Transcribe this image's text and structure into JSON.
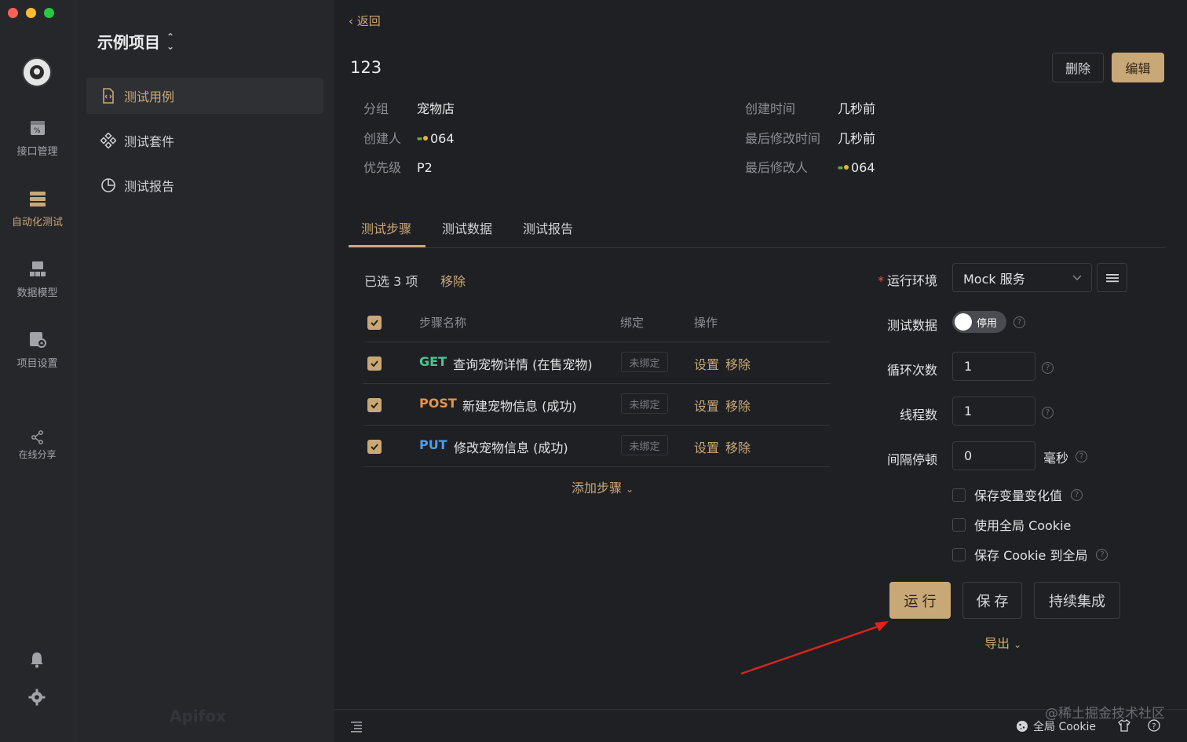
{
  "rail": {
    "items": [
      {
        "label": "接口管理",
        "icon": "api-management-icon"
      },
      {
        "label": "自动化测试",
        "icon": "automation-test-icon",
        "active": true
      },
      {
        "label": "数据模型",
        "icon": "data-model-icon"
      },
      {
        "label": "项目设置",
        "icon": "project-settings-icon"
      },
      {
        "label": "在线分享",
        "icon": "share-icon"
      }
    ]
  },
  "sidebar": {
    "project_title": "示例项目",
    "items": [
      {
        "label": "测试用例",
        "icon": "test-case-icon",
        "active": true
      },
      {
        "label": "测试套件",
        "icon": "test-suite-icon"
      },
      {
        "label": "测试报告",
        "icon": "test-report-icon"
      }
    ],
    "brand": "Apifox"
  },
  "header": {
    "back_label": "返回",
    "title": "123",
    "delete_label": "删除",
    "edit_label": "编辑"
  },
  "meta": {
    "group_key": "分组",
    "group_value": "宠物店",
    "creator_key": "创建人",
    "creator_value": "064",
    "priority_key": "优先级",
    "priority_value": "P2",
    "created_key": "创建时间",
    "created_value": "几秒前",
    "modified_key": "最后修改时间",
    "modified_value": "几秒前",
    "modifier_key": "最后修改人",
    "modifier_value": "064"
  },
  "tabs": [
    {
      "label": "测试步骤",
      "active": true
    },
    {
      "label": "测试数据"
    },
    {
      "label": "测试报告"
    }
  ],
  "steps": {
    "selected_text": "已选 3 项",
    "remove_label": "移除",
    "columns": {
      "name": "步骤名称",
      "bind": "绑定",
      "ops": "操作"
    },
    "rows": [
      {
        "method": "GET",
        "name": "查询宠物详情 (在售宠物)",
        "bind": "未绑定",
        "set": "设置",
        "remove": "移除",
        "checked": true
      },
      {
        "method": "POST",
        "name": "新建宠物信息 (成功)",
        "bind": "未绑定",
        "set": "设置",
        "remove": "移除",
        "checked": true
      },
      {
        "method": "PUT",
        "name": "修改宠物信息 (成功)",
        "bind": "未绑定",
        "set": "设置",
        "remove": "移除",
        "checked": true
      }
    ],
    "add_step_label": "添加步骤"
  },
  "run_config": {
    "env_label": "运行环境",
    "env_value": "Mock 服务",
    "test_data_label": "测试数据",
    "test_data_toggle": "停用",
    "loop_label": "循环次数",
    "loop_value": "1",
    "threads_label": "线程数",
    "threads_value": "1",
    "interval_label": "间隔停顿",
    "interval_value": "0",
    "interval_unit": "毫秒",
    "opt_save_var": "保存变量变化值",
    "opt_global_cookie": "使用全局 Cookie",
    "opt_save_cookie": "保存 Cookie 到全局",
    "run_label": "运 行",
    "save_label": "保 存",
    "ci_label": "持续集成",
    "export_label": "导出"
  },
  "footer": {
    "cookie_label": "全局 Cookie",
    "watermark": "@稀土掘金技术社区"
  },
  "colors": {
    "accent": "#c9a877",
    "get": "#4dc493",
    "post": "#e8934a",
    "put": "#4d9ef0",
    "annotation_arrow": "#e0221b"
  }
}
